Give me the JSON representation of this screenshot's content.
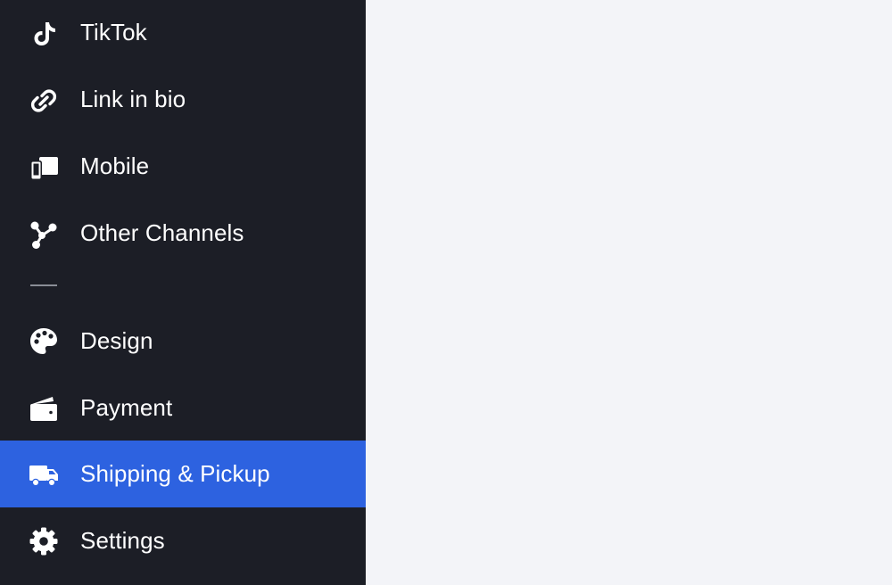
{
  "sidebar": {
    "items": [
      {
        "label": "TikTok",
        "icon": "tiktok-icon"
      },
      {
        "label": "Link in bio",
        "icon": "link-icon"
      },
      {
        "label": "Mobile",
        "icon": "mobile-devices-icon"
      },
      {
        "label": "Other Channels",
        "icon": "channels-network-icon"
      },
      {
        "label": "Design",
        "icon": "palette-icon"
      },
      {
        "label": "Payment",
        "icon": "wallet-icon"
      },
      {
        "label": "Shipping & Pickup",
        "icon": "truck-icon",
        "active": true
      },
      {
        "label": "Settings",
        "icon": "gear-icon"
      }
    ]
  },
  "colors": {
    "sidebar_bg": "#1c1e26",
    "active_bg": "#2d62e0",
    "main_bg": "#f3f4f8",
    "text": "#ffffff"
  }
}
